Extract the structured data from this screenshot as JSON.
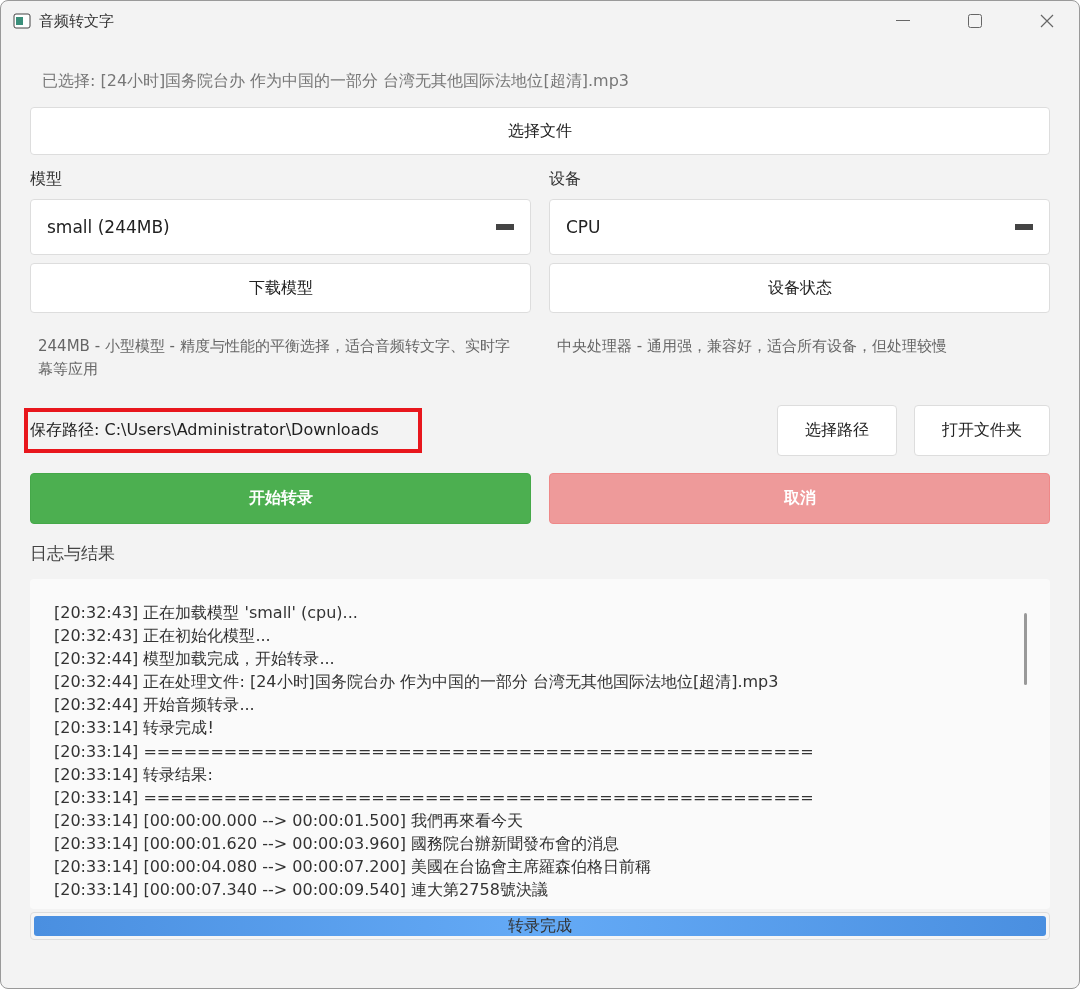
{
  "window": {
    "title": "音频转文字"
  },
  "selected_file": "已选择: [24小时]国务院台办 作为中国的一部分 台湾无其他国际法地位[超清].mp3",
  "select_file_button": "选择文件",
  "model": {
    "label": "模型",
    "value": "small (244MB)",
    "button": "下载模型",
    "description": "244MB - 小型模型 - 精度与性能的平衡选择，适合音频转文字、实时字幕等应用"
  },
  "device": {
    "label": "设备",
    "value": "CPU",
    "button": "设备状态",
    "description": "中央处理器 - 通用强，兼容好，适合所有设备，但处理较慢"
  },
  "save_path": {
    "text": "保存路径: C:\\Users\\Administrator\\Downloads",
    "highlighted": true
  },
  "path_buttons": [
    "选择路径",
    "打开文件夹"
  ],
  "actions": [
    {
      "label": "开始转录",
      "kind": "primary",
      "disabled": false
    },
    {
      "label": "取消",
      "kind": "danger",
      "disabled": true
    }
  ],
  "log": {
    "title": "日志与结果",
    "lines": [
      "[20:32:43] 正在加载模型 'small' (cpu)...",
      "[20:32:43] 正在初始化模型...",
      "[20:32:44] 模型加载完成，开始转录...",
      "[20:32:44] 正在处理文件: [24小时]国务院台办 作为中国的一部分 台湾无其他国际法地位[超清].mp3",
      "[20:32:44] 开始音频转录...",
      "[20:33:14] 转录完成!",
      "[20:33:14] ==================================================",
      "[20:33:14] 转录结果:",
      "[20:33:14] ==================================================",
      "[20:33:14] [00:00:00.000 --> 00:00:01.500] 我們再來看今天",
      "[20:33:14] [00:00:01.620 --> 00:00:03.960] 國務院台辦新聞發布會的消息",
      "[20:33:14] [00:00:04.080 --> 00:00:07.200] 美國在台協會主席羅森伯格日前稱",
      "[20:33:14] [00:00:07.340 --> 00:00:09.540] 連大第2758號決議"
    ]
  },
  "progress": {
    "label": "转录完成",
    "level": 1
  }
}
